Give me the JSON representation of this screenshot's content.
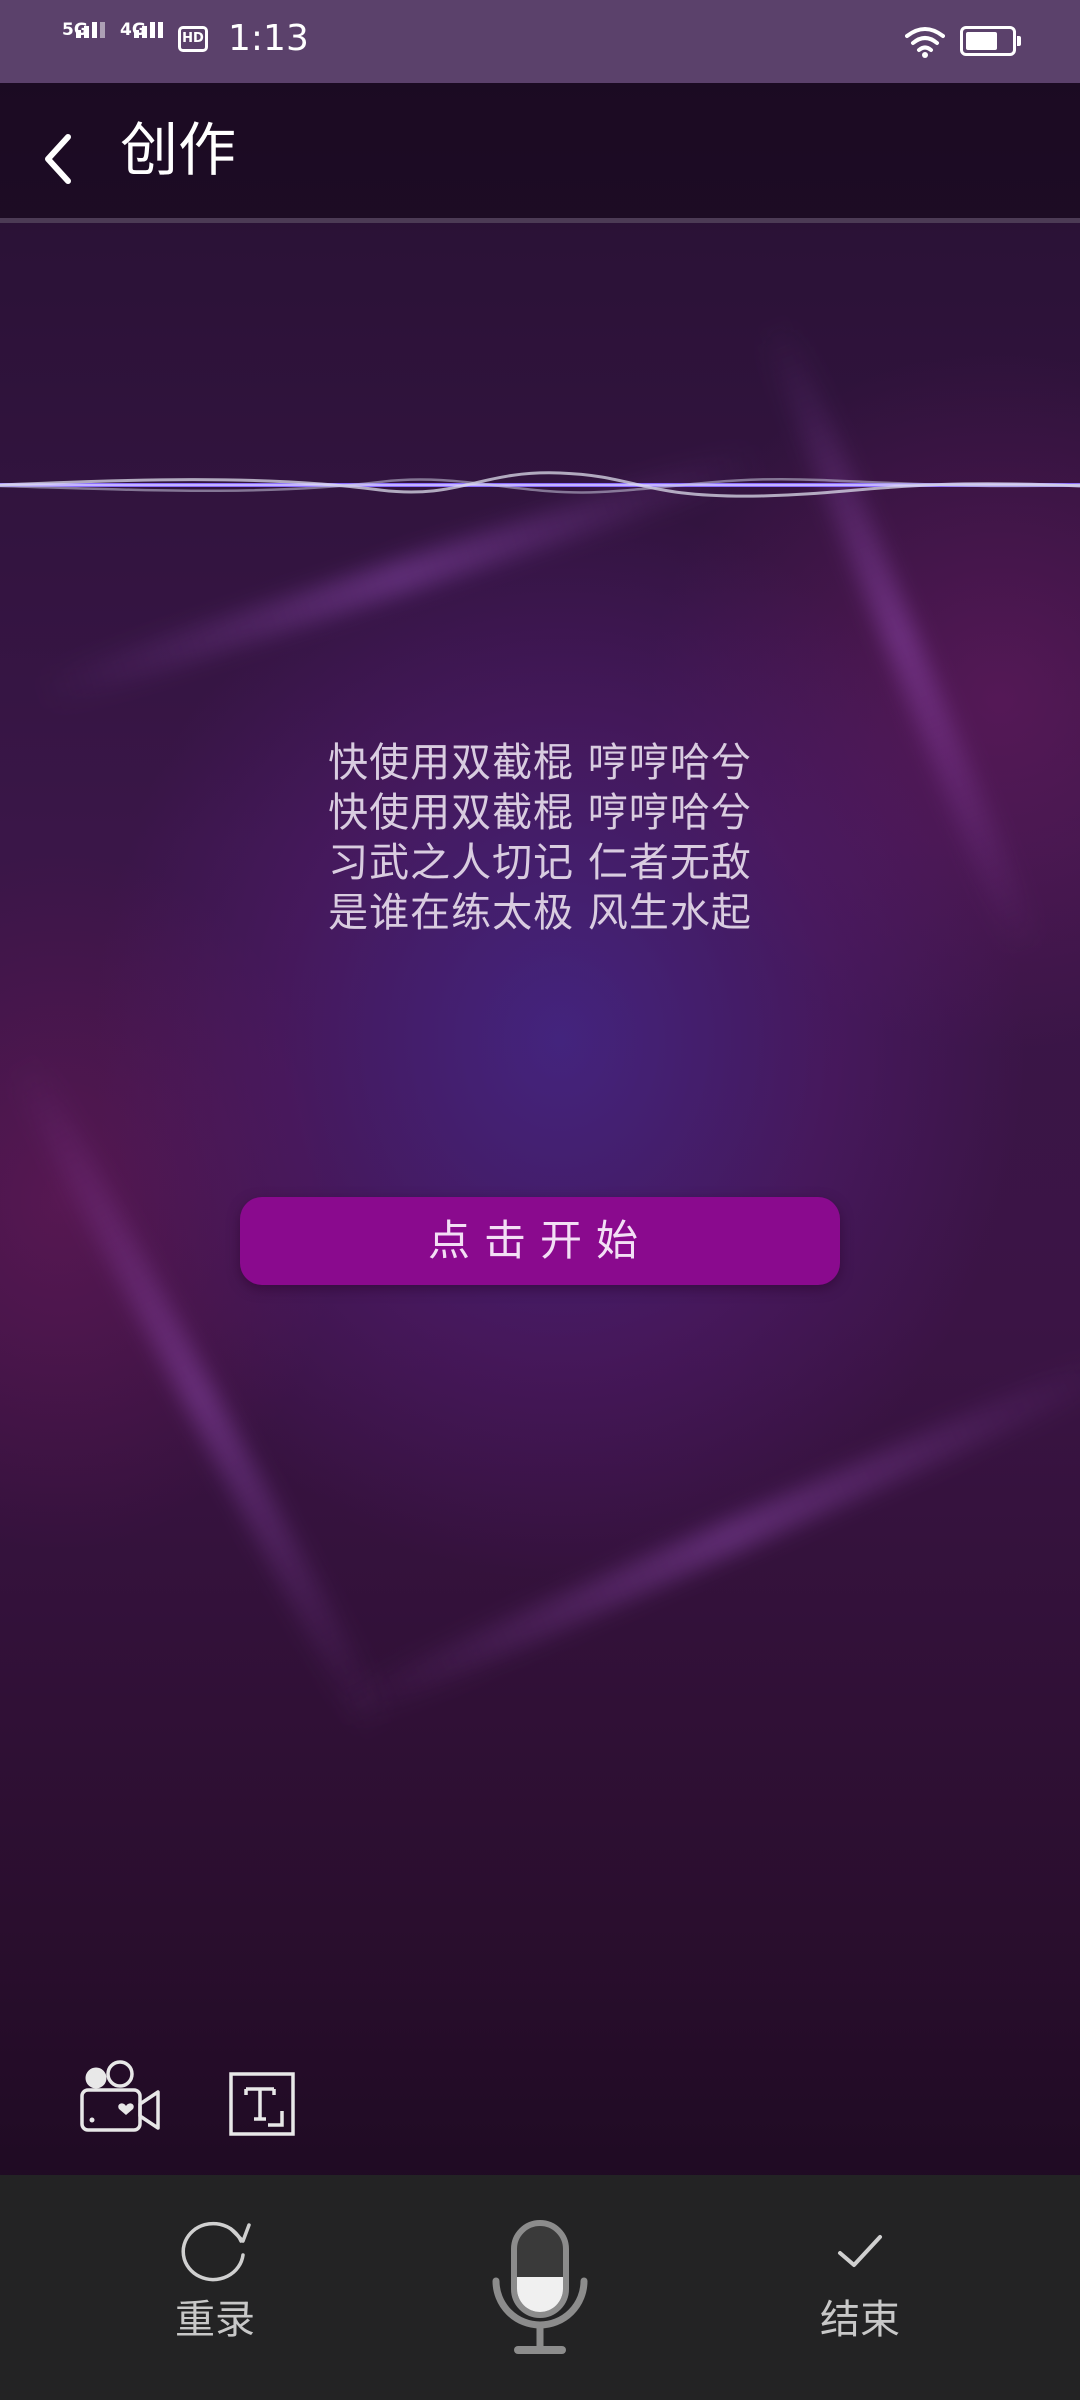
{
  "status_bar": {
    "network_1": "5G",
    "network_2": "4G",
    "hd_label": "HD",
    "time": "1:13",
    "battery_level": 0.7,
    "icons": [
      "signal-icon",
      "signal-icon",
      "hd-icon",
      "wifi-icon",
      "battery-icon"
    ]
  },
  "header": {
    "back_icon": "chevron-left-icon",
    "title": "创作"
  },
  "lyrics": [
    "快使用双截棍 哼哼哈兮",
    "快使用双截棍 哼哼哈兮",
    "习武之人切记 仁者无敌",
    "是谁在练太极 风生水起"
  ],
  "start_button": {
    "label": "点击开始"
  },
  "tools": {
    "camera_icon": "video-camera-icon",
    "text_icon": "text-frame-icon"
  },
  "bottom_bar": {
    "rerecord_label": "重录",
    "finish_label": "结束",
    "mic_icon": "microphone-icon"
  },
  "colors": {
    "accent": "#8a0a8e",
    "status_bar": "#5b416b",
    "bottom_bar": "#232324",
    "waveform": "#8a6cff"
  }
}
